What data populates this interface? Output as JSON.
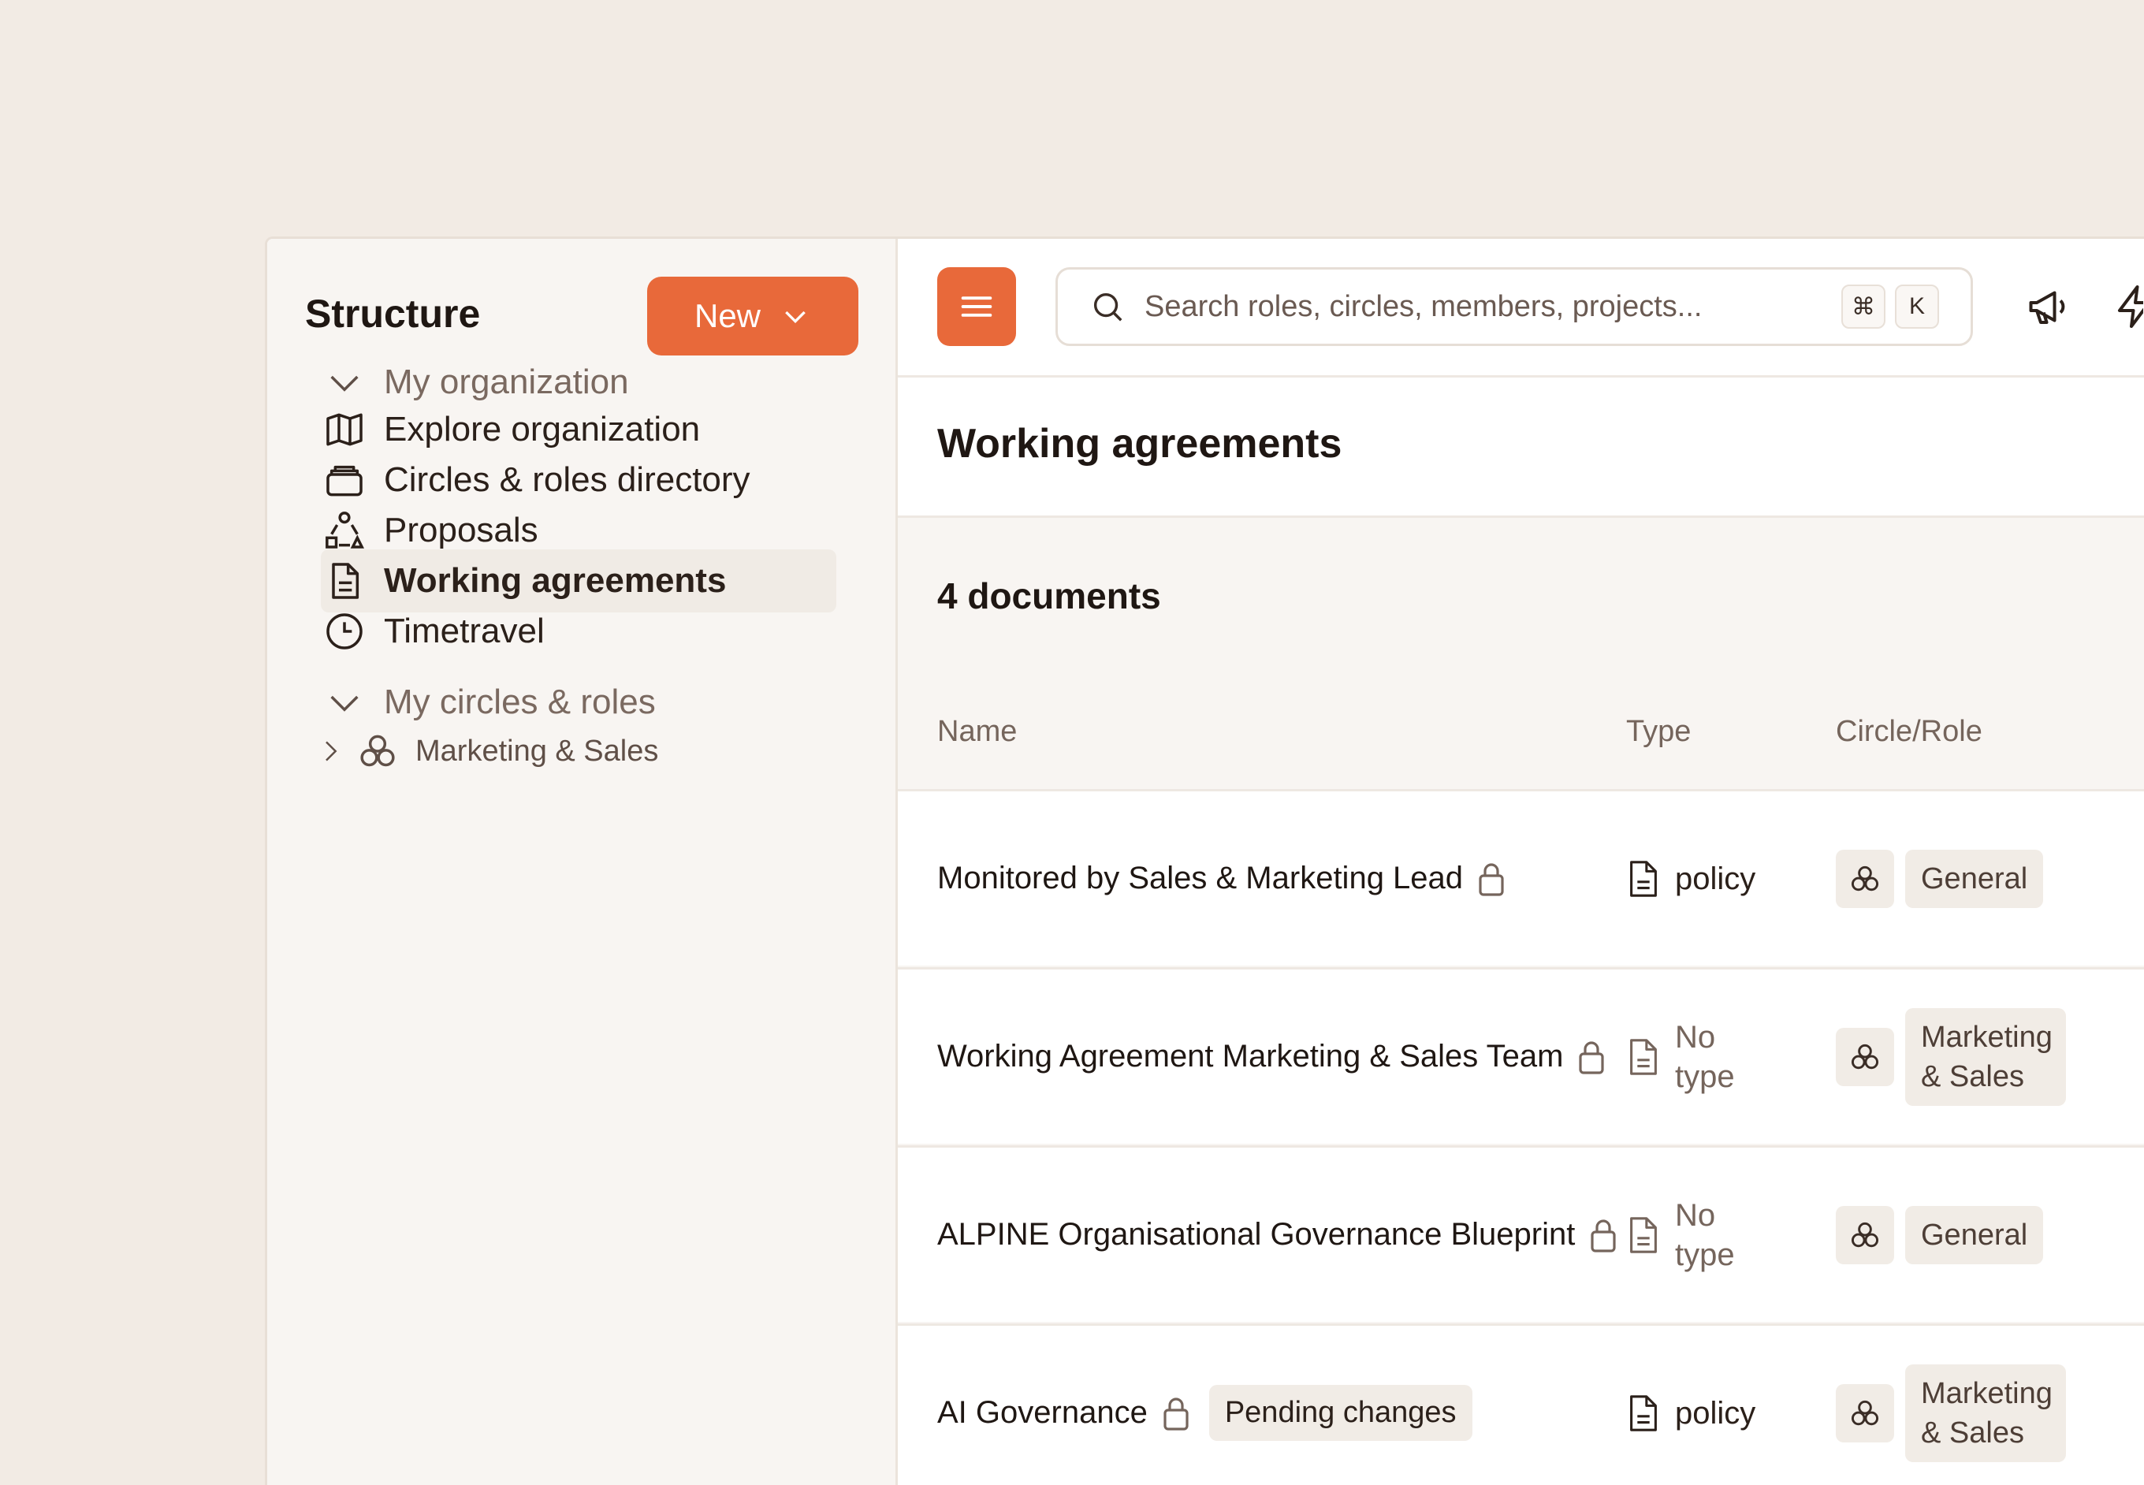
{
  "sidebar": {
    "title": "Structure",
    "new_button": "New",
    "section_org": "My organization",
    "items": [
      {
        "label": "Explore organization"
      },
      {
        "label": "Circles & roles directory"
      },
      {
        "label": "Proposals"
      },
      {
        "label": "Working agreements"
      },
      {
        "label": "Timetravel"
      }
    ],
    "section_circles": "My circles & roles",
    "circles": [
      {
        "label": "Marketing & Sales"
      }
    ]
  },
  "topbar": {
    "search_placeholder": "Search roles, circles, members, projects...",
    "shortcut_mod": "⌘",
    "shortcut_key": "K"
  },
  "page": {
    "title": "Working agreements",
    "count": "4 documents",
    "columns": {
      "name": "Name",
      "type": "Type",
      "circle": "Circle/Role"
    }
  },
  "documents": [
    {
      "name": "Monitored by Sales & Marketing Lead",
      "type": "policy",
      "circle": "General"
    },
    {
      "name": "Working Agreement Marketing & Sales Team",
      "type": "No type",
      "circle": "Marketing & Sales"
    },
    {
      "name": "ALPINE Organisational Governance Blueprint",
      "type": "No type",
      "circle": "General"
    },
    {
      "name": "AI Governance",
      "badge": "Pending changes",
      "type": "policy",
      "circle": "Marketing & Sales"
    }
  ],
  "colors": {
    "accent": "#e8693a",
    "background": "#f2ebe4",
    "sidebar": "#f8f5f2"
  }
}
